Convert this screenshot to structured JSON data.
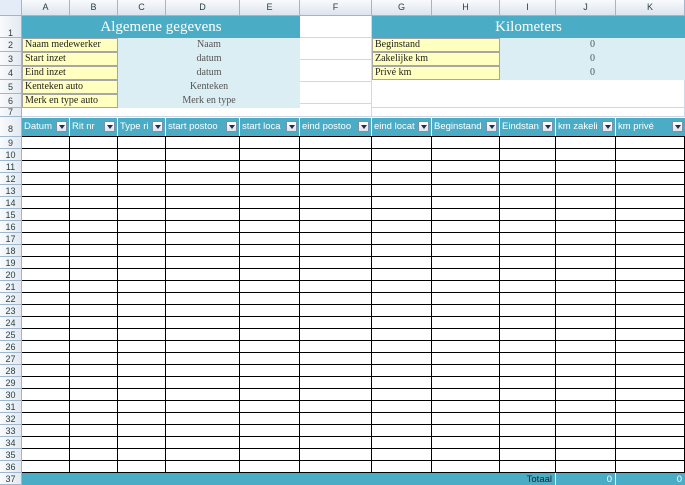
{
  "columns": [
    "A",
    "B",
    "C",
    "D",
    "E",
    "F",
    "G",
    "H",
    "I",
    "J",
    "K"
  ],
  "rows": [
    "1",
    "2",
    "3",
    "4",
    "5",
    "6",
    "7",
    "8",
    "9",
    "10",
    "11",
    "12",
    "13",
    "14",
    "15",
    "16",
    "17",
    "18",
    "19",
    "20",
    "21",
    "22",
    "23",
    "24",
    "25",
    "26",
    "27",
    "28",
    "29",
    "30",
    "31",
    "32",
    "33",
    "34",
    "35",
    "36",
    "37"
  ],
  "general": {
    "title": "Algemene gegevens",
    "labels": [
      "Naam medewerker",
      "Start inzet",
      "Eind inzet",
      "Kenteken auto",
      "Merk en type auto"
    ],
    "values": [
      "Naam",
      "datum",
      "datum",
      "Kenteken",
      "Merk en type"
    ]
  },
  "km": {
    "title": "Kilometers",
    "labels": [
      "Beginstand",
      "Zakelijke km",
      "Privé km"
    ],
    "values": [
      "0",
      "0",
      "0"
    ]
  },
  "table": {
    "headers": [
      "Datum",
      "Rit nr",
      "Type ri",
      "start postoo",
      "start loca",
      "eind postoo",
      "eind locat",
      "Beginstand",
      "Eindstan",
      "km zakeli",
      "km privé"
    ]
  },
  "totals": {
    "label": "Totaal",
    "km_zakelijk": "0",
    "km_prive": "0"
  },
  "colors": {
    "header_blue": "#4bacc6",
    "label_yellow": "#ffffc0",
    "value_blue": "#daeef3"
  }
}
